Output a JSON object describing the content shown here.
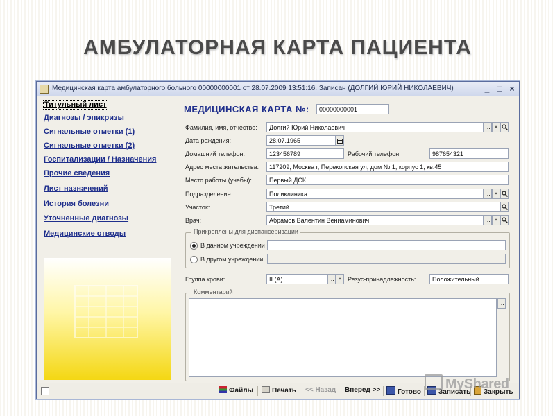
{
  "slide": {
    "title": "АМБУЛАТОРНАЯ КАРТА ПАЦИЕНТА",
    "watermark": "MyShared"
  },
  "window": {
    "title": "Медицинская карта амбулаторного больного 00000000001 от 28.07.2009 13:51:16. Записан (ДОЛГИЙ ЮРИЙ НИКОЛАЕВИЧ)",
    "controls": [
      "_",
      "□",
      "×"
    ]
  },
  "nav": {
    "items": [
      "Титульный лист",
      "Диагнозы / эпикризы",
      "Сигнальные отметки (1)",
      "Сигнальные отметки (2)",
      "Госпитализации / Назначения",
      "Прочие сведения",
      "Лист назначений",
      "История болезни",
      "Уточненные диагнозы",
      "Медицинские отводы"
    ],
    "active_index": 0
  },
  "form": {
    "card_label": "МЕДИЦИНСКАЯ КАРТА №:",
    "card_number": "00000000001",
    "fio_label": "Фамилия, имя, отчество:",
    "fio": "Долгий Юрий Николаевич",
    "birth_label": "Дата рождения:",
    "birth": "28.07.1965",
    "home_phone_label": "Домашний телефон:",
    "home_phone": "123456789",
    "work_phone_label": "Рабочий телефон:",
    "work_phone": "987654321",
    "address_label": "Адрес места жительства:",
    "address": "117209, Москва г, Перекопская ул, дом № 1, корпус 1, кв.45",
    "workplace_label": "Место работы (учебы):",
    "workplace": "Первый ДСК",
    "department_label": "Подразделение:",
    "department": "Поликлиника",
    "district_label": "Участок:",
    "district": "Третий",
    "doctor_label": "Врач:",
    "doctor": "Абрамов Валентин Вениаминович",
    "dispensary_legend": "Прикреплены для диспансеризации",
    "radio_here_label": "В данном учреждении",
    "radio_other_label": "В другом учреждении",
    "radio_selected": "here",
    "blood_label": "Группа крови:",
    "blood": "II (A)",
    "rh_label": "Резус-принадлежность:",
    "rh": "Положительный",
    "comment_legend": "Комментарий",
    "select_btn": "...",
    "clear_btn": "×"
  },
  "statusbar": {
    "files": "Файлы",
    "print": "Печать",
    "back": "<< Назад",
    "forward": "Вперед >>",
    "done": "Готово",
    "save": "Записать",
    "close": "Закрыть"
  }
}
